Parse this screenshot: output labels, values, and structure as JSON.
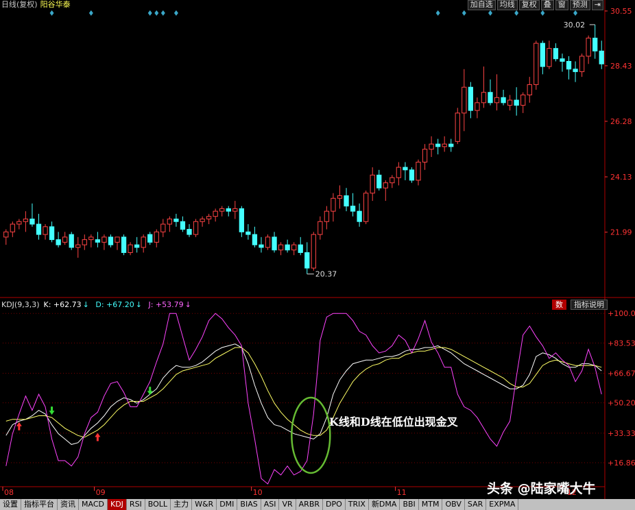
{
  "header": {
    "mode_label": "日线(复权)",
    "stock_name": "阳谷华泰",
    "buttons": [
      "加自选",
      "均线",
      "复权",
      "叠",
      "窗",
      "预测",
      "⇥"
    ]
  },
  "kdj": {
    "name": "KDJ(9,3,3)",
    "k_label": "K: +62.73",
    "d_label": "D: +67.20",
    "j_label": "J: +53.79",
    "button_shu": "数",
    "button_desc": "指标说明"
  },
  "annotation_text": "K线和D线在低位出现金叉",
  "watermark": "头条 @陆家嘴大牛",
  "tabs": [
    "设置",
    "指标平台",
    "资讯",
    "MACD",
    "KDJ",
    "RSI",
    "BOLL",
    "主力",
    "W&R",
    "DMI",
    "BIAS",
    "ASI",
    "VR",
    "ARBR",
    "DPO",
    "TRIX",
    "新DMA",
    "BBI",
    "MTM",
    "OBV",
    "SAR",
    "EXPMA"
  ],
  "active_tab": "KDJ",
  "colors": {
    "up": "#ff4444",
    "down": "#44ffff",
    "k_line": "#ffffff",
    "d_line": "#ffff66",
    "j_line": "#ff44ff",
    "axis_text": "#ff3333",
    "ellipse": "#66bb33"
  },
  "chart_data": [
    {
      "type": "candlestick",
      "y_ticks": [
        21.99,
        24.13,
        26.28,
        28.43,
        30.55
      ],
      "ylim": [
        19.7,
        30.55
      ],
      "high_marker": "30.02",
      "low_marker": "20.37",
      "x_tick_labels": [
        "08",
        "09",
        "10",
        "11",
        "12"
      ],
      "x_tick_index": [
        0,
        14,
        38,
        60,
        86
      ],
      "ohlc": [
        [
          21.8,
          22.1,
          21.5,
          22.0
        ],
        [
          22.0,
          22.4,
          21.8,
          22.3
        ],
        [
          22.3,
          22.5,
          22.1,
          22.4
        ],
        [
          22.4,
          22.8,
          22.0,
          22.5
        ],
        [
          22.5,
          23.1,
          22.2,
          22.3
        ],
        [
          22.3,
          22.7,
          21.7,
          21.9
        ],
        [
          21.9,
          22.3,
          21.7,
          22.2
        ],
        [
          22.2,
          22.4,
          21.6,
          21.7
        ],
        [
          21.7,
          22.0,
          21.4,
          21.5
        ],
        [
          21.6,
          22.0,
          21.5,
          21.8
        ],
        [
          21.9,
          22.0,
          21.3,
          21.4
        ],
        [
          21.4,
          21.8,
          21.0,
          21.5
        ],
        [
          21.5,
          21.9,
          21.3,
          21.7
        ],
        [
          21.7,
          21.9,
          21.4,
          21.8
        ],
        [
          21.7,
          22.0,
          21.4,
          21.6
        ],
        [
          21.6,
          21.9,
          21.3,
          21.8
        ],
        [
          21.8,
          21.9,
          21.4,
          21.5
        ],
        [
          21.6,
          21.8,
          21.3,
          21.8
        ],
        [
          21.8,
          21.9,
          21.1,
          21.2
        ],
        [
          21.2,
          21.6,
          21.1,
          21.5
        ],
        [
          21.5,
          21.8,
          21.2,
          21.4
        ],
        [
          21.4,
          21.9,
          21.2,
          21.8
        ],
        [
          21.9,
          22.0,
          21.5,
          21.6
        ],
        [
          21.6,
          22.1,
          21.4,
          22.0
        ],
        [
          22.0,
          22.5,
          21.8,
          22.3
        ],
        [
          22.3,
          22.6,
          22.0,
          22.5
        ],
        [
          22.5,
          22.7,
          22.2,
          22.4
        ],
        [
          22.4,
          22.6,
          22.0,
          22.1
        ],
        [
          22.1,
          22.3,
          21.8,
          21.9
        ],
        [
          21.9,
          22.5,
          21.8,
          22.4
        ],
        [
          22.4,
          22.6,
          22.2,
          22.5
        ],
        [
          22.5,
          22.7,
          22.3,
          22.6
        ],
        [
          22.6,
          22.9,
          22.4,
          22.8
        ],
        [
          22.8,
          23.0,
          22.6,
          22.9
        ],
        [
          22.9,
          23.0,
          22.6,
          22.8
        ],
        [
          22.8,
          23.2,
          22.5,
          22.9
        ],
        [
          22.9,
          23.0,
          21.8,
          22.0
        ],
        [
          22.0,
          22.3,
          21.7,
          21.9
        ],
        [
          21.9,
          22.2,
          21.4,
          21.5
        ],
        [
          21.5,
          21.8,
          21.2,
          21.4
        ],
        [
          21.4,
          21.9,
          21.3,
          21.8
        ],
        [
          21.8,
          22.0,
          21.2,
          21.3
        ],
        [
          21.3,
          21.6,
          21.1,
          21.5
        ],
        [
          21.5,
          21.7,
          21.2,
          21.3
        ],
        [
          21.3,
          21.6,
          21.1,
          21.5
        ],
        [
          21.5,
          21.8,
          21.1,
          21.2
        ],
        [
          21.2,
          21.6,
          20.37,
          20.6
        ],
        [
          20.6,
          22.0,
          20.5,
          21.9
        ],
        [
          21.9,
          22.6,
          21.7,
          22.4
        ],
        [
          22.4,
          23.0,
          22.1,
          22.8
        ],
        [
          22.8,
          23.5,
          22.4,
          23.3
        ],
        [
          23.3,
          23.8,
          22.9,
          23.4
        ],
        [
          23.4,
          23.7,
          22.8,
          23.0
        ],
        [
          23.0,
          23.5,
          22.6,
          22.8
        ],
        [
          22.8,
          23.1,
          22.2,
          22.4
        ],
        [
          22.4,
          23.6,
          22.3,
          23.5
        ],
        [
          23.5,
          24.5,
          23.2,
          24.2
        ],
        [
          24.2,
          24.4,
          23.6,
          23.7
        ],
        [
          23.7,
          24.0,
          23.2,
          23.9
        ],
        [
          23.9,
          24.2,
          23.7,
          24.1
        ],
        [
          24.1,
          24.7,
          23.8,
          24.5
        ],
        [
          24.5,
          24.7,
          24.0,
          24.4
        ],
        [
          24.4,
          24.5,
          23.9,
          24.0
        ],
        [
          24.0,
          24.8,
          23.8,
          24.7
        ],
        [
          24.7,
          25.4,
          24.4,
          25.2
        ],
        [
          25.2,
          25.7,
          24.9,
          25.4
        ],
        [
          25.4,
          25.6,
          25.0,
          25.3
        ],
        [
          25.3,
          25.7,
          25.1,
          25.4
        ],
        [
          25.4,
          25.6,
          25.1,
          25.3
        ],
        [
          25.5,
          26.8,
          25.4,
          26.6
        ],
        [
          26.6,
          28.3,
          25.9,
          27.6
        ],
        [
          27.6,
          27.8,
          26.4,
          26.7
        ],
        [
          26.7,
          27.2,
          26.4,
          27.0
        ],
        [
          27.0,
          28.4,
          26.8,
          27.4
        ],
        [
          27.4,
          27.9,
          26.9,
          27.0
        ],
        [
          27.0,
          28.1,
          26.7,
          27.2
        ],
        [
          27.2,
          27.5,
          26.9,
          27.0
        ],
        [
          26.9,
          27.3,
          26.7,
          27.1
        ],
        [
          27.1,
          27.6,
          26.5,
          26.9
        ],
        [
          26.9,
          27.4,
          26.6,
          27.3
        ],
        [
          27.3,
          28.0,
          27.0,
          27.7
        ],
        [
          27.7,
          29.4,
          27.5,
          29.3
        ],
        [
          29.3,
          29.4,
          28.1,
          28.4
        ],
        [
          28.4,
          29.4,
          28.3,
          29.1
        ],
        [
          29.1,
          29.3,
          28.6,
          28.7
        ],
        [
          28.7,
          28.9,
          28.2,
          28.6
        ],
        [
          28.6,
          28.8,
          27.9,
          28.3
        ],
        [
          28.3,
          28.6,
          27.8,
          28.2
        ],
        [
          28.2,
          28.9,
          28.0,
          28.8
        ],
        [
          28.8,
          29.6,
          28.5,
          29.5
        ],
        [
          29.5,
          30.02,
          28.7,
          29.0
        ],
        [
          29.0,
          29.4,
          28.3,
          28.5
        ]
      ]
    },
    {
      "type": "line",
      "y_ticks": [
        16.86,
        33.33,
        50.2,
        66.67,
        83.53,
        100.0
      ],
      "ylim": [
        5,
        102
      ],
      "series": [
        {
          "name": "K",
          "values": [
            32,
            38,
            40,
            41,
            43,
            46,
            44,
            38,
            33,
            30,
            27,
            28,
            32,
            36,
            39,
            43,
            48,
            51,
            53,
            52,
            50,
            52,
            55,
            58,
            64,
            68,
            71,
            70,
            70,
            71,
            73,
            76,
            79,
            81,
            82,
            83,
            81,
            72,
            60,
            50,
            42,
            38,
            37,
            35,
            33,
            32,
            31,
            30,
            33,
            42,
            55,
            63,
            68,
            72,
            73,
            74,
            74,
            75,
            76,
            76,
            77,
            79,
            80,
            80,
            81,
            81,
            82,
            80,
            78,
            75,
            72,
            70,
            68,
            66,
            64,
            62,
            60,
            58,
            58,
            60,
            66,
            76,
            78,
            77,
            75,
            72,
            70,
            70,
            72,
            72,
            71,
            68
          ]
        },
        {
          "name": "D",
          "values": [
            40,
            41,
            41,
            41,
            42,
            43,
            43,
            42,
            39,
            36,
            34,
            32,
            31,
            33,
            35,
            38,
            42,
            46,
            49,
            51,
            51,
            51,
            53,
            55,
            58,
            62,
            66,
            68,
            69,
            70,
            71,
            72,
            75,
            77,
            79,
            81,
            81,
            78,
            72,
            65,
            57,
            50,
            45,
            41,
            38,
            35,
            33,
            32,
            32,
            35,
            42,
            50,
            56,
            62,
            66,
            69,
            71,
            72,
            74,
            75,
            75,
            77,
            78,
            79,
            79,
            80,
            81,
            81,
            80,
            78,
            76,
            74,
            72,
            70,
            68,
            66,
            64,
            61,
            59,
            59,
            61,
            66,
            71,
            73,
            74,
            73,
            72,
            71,
            71,
            71,
            71,
            70
          ]
        },
        {
          "name": "J",
          "values": [
            15,
            33,
            44,
            54,
            46,
            55,
            48,
            30,
            18,
            18,
            15,
            20,
            33,
            42,
            45,
            54,
            61,
            62,
            56,
            48,
            48,
            55,
            62,
            73,
            83,
            100,
            100,
            87,
            74,
            80,
            87,
            96,
            100,
            97,
            92,
            88,
            82,
            50,
            30,
            8,
            5,
            13,
            10,
            15,
            10,
            12,
            18,
            44,
            85,
            98,
            100,
            100,
            100,
            96,
            90,
            88,
            82,
            78,
            79,
            82,
            88,
            85,
            78,
            86,
            96,
            84,
            78,
            70,
            70,
            55,
            48,
            46,
            42,
            36,
            30,
            26,
            34,
            40,
            65,
            88,
            93,
            87,
            82,
            75,
            78,
            74,
            71,
            62,
            68,
            80,
            70,
            55
          ]
        }
      ]
    }
  ]
}
